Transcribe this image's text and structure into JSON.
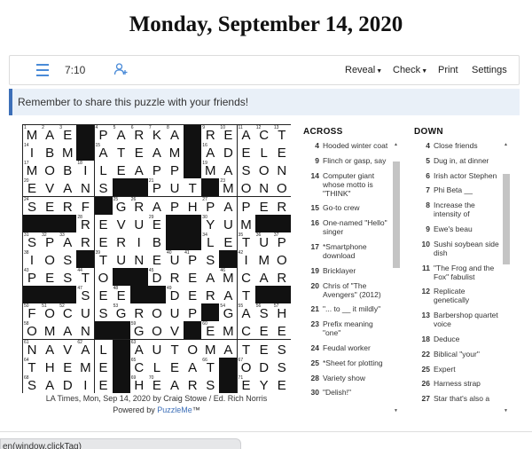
{
  "page": {
    "title": "Monday, September 14, 2020"
  },
  "toolbar": {
    "timer": "7:10",
    "reveal_label": "Reveal",
    "check_label": "Check",
    "print_label": "Print",
    "settings_label": "Settings",
    "menu_icon": "hamburger-icon",
    "user_icon": "add-user-icon"
  },
  "banner": {
    "text": "Remember to share this puzzle with your friends!"
  },
  "puzzle": {
    "credit": "LA Times, Mon, Sep 14, 2020 by Craig Stowe / Ed. Rich Norris",
    "powered_by_prefix": "Powered by ",
    "powered_by_link": "PuzzleMe",
    "powered_by_suffix": "™",
    "rows": [
      "MAE#PARKA#REACT",
      "IBM#ATEAM#ADELE",
      "MOBILEAPP#MASON",
      "EVANS##PUT#MONO",
      "SERF#GRAPHPAPER",
      "###REVUE##YUM##",
      "SPARERIB##LETUP",
      "IOS#TUNEUPS#IMO",
      "PESTO##DREAMCAR",
      "###SEE##DERAT##",
      "FOCUSGROUP#GASH",
      "OMAN##GOV#EMCEE",
      "NAVAL#AUTOMATES",
      "THEME#CLEAT#ODS",
      "SADIE#HEARS#EYE"
    ],
    "numbers": [
      [
        1,
        2,
        3,
        0,
        4,
        5,
        6,
        7,
        8,
        0,
        9,
        10,
        11,
        12,
        13
      ],
      [
        14,
        0,
        0,
        0,
        15,
        0,
        0,
        0,
        0,
        0,
        16,
        0,
        0,
        0,
        0
      ],
      [
        17,
        0,
        0,
        18,
        0,
        0,
        0,
        0,
        0,
        0,
        19,
        0,
        0,
        0,
        0
      ],
      [
        20,
        0,
        0,
        0,
        0,
        0,
        0,
        21,
        0,
        0,
        22,
        23,
        0,
        0,
        0
      ],
      [
        24,
        0,
        0,
        0,
        0,
        25,
        26,
        0,
        0,
        0,
        27,
        0,
        0,
        0,
        0
      ],
      [
        0,
        0,
        0,
        28,
        0,
        0,
        0,
        29,
        0,
        0,
        30,
        0,
        0,
        0,
        0
      ],
      [
        31,
        32,
        33,
        0,
        0,
        0,
        0,
        0,
        0,
        0,
        34,
        0,
        35,
        36,
        37
      ],
      [
        38,
        0,
        0,
        0,
        39,
        0,
        0,
        0,
        40,
        41,
        0,
        0,
        42,
        0,
        0
      ],
      [
        43,
        0,
        0,
        44,
        0,
        0,
        0,
        45,
        0,
        0,
        0,
        46,
        0,
        0,
        0
      ],
      [
        0,
        0,
        0,
        47,
        0,
        48,
        0,
        0,
        49,
        0,
        0,
        0,
        0,
        0,
        0
      ],
      [
        50,
        51,
        52,
        0,
        0,
        53,
        0,
        0,
        0,
        0,
        0,
        54,
        55,
        56,
        57
      ],
      [
        58,
        0,
        0,
        0,
        0,
        0,
        59,
        0,
        0,
        0,
        60,
        0,
        0,
        0,
        0
      ],
      [
        61,
        0,
        0,
        62,
        0,
        0,
        63,
        0,
        0,
        0,
        0,
        0,
        0,
        0,
        0
      ],
      [
        64,
        0,
        0,
        0,
        0,
        0,
        65,
        0,
        0,
        0,
        66,
        0,
        67,
        0,
        0
      ],
      [
        68,
        0,
        0,
        0,
        0,
        0,
        69,
        70,
        0,
        0,
        0,
        0,
        71,
        0,
        0
      ]
    ]
  },
  "across": {
    "heading": "ACROSS",
    "clues": [
      {
        "num": "4",
        "text": "Hooded winter coat"
      },
      {
        "num": "9",
        "text": "Flinch or gasp, say"
      },
      {
        "num": "14",
        "text": "Computer giant whose motto is \"THINK\""
      },
      {
        "num": "15",
        "text": "Go-to crew"
      },
      {
        "num": "16",
        "text": "One-named \"Hello\" singer"
      },
      {
        "num": "17",
        "text": "*Smartphone download"
      },
      {
        "num": "19",
        "text": "Bricklayer"
      },
      {
        "num": "20",
        "text": "Chris of \"The Avengers\" (2012)"
      },
      {
        "num": "21",
        "text": "\"... to __ it mildly\""
      },
      {
        "num": "23",
        "text": "Prefix meaning \"one\""
      },
      {
        "num": "24",
        "text": "Feudal worker"
      },
      {
        "num": "25",
        "text": "*Sheet for plotting"
      },
      {
        "num": "28",
        "text": "Variety show"
      },
      {
        "num": "30",
        "text": "\"Delish!\""
      }
    ]
  },
  "down": {
    "heading": "DOWN",
    "clues": [
      {
        "num": "4",
        "text": "Close friends"
      },
      {
        "num": "5",
        "text": "Dug in, at dinner"
      },
      {
        "num": "6",
        "text": "Irish actor Stephen"
      },
      {
        "num": "7",
        "text": "Phi Beta __"
      },
      {
        "num": "8",
        "text": "Increase the intensity of"
      },
      {
        "num": "9",
        "text": "Ewe's beau"
      },
      {
        "num": "10",
        "text": "Sushi soybean side dish"
      },
      {
        "num": "11",
        "text": "\"The Frog and the Fox\" fabulist"
      },
      {
        "num": "12",
        "text": "Replicate genetically"
      },
      {
        "num": "13",
        "text": "Barbershop quartet voice"
      },
      {
        "num": "18",
        "text": "Deduce"
      },
      {
        "num": "22",
        "text": "Biblical \"your\""
      },
      {
        "num": "25",
        "text": "Expert"
      },
      {
        "num": "26",
        "text": "Harness strap"
      },
      {
        "num": "27",
        "text": "Star that's also a"
      }
    ]
  },
  "status_bar": {
    "text": "en(window.clickTag)"
  }
}
